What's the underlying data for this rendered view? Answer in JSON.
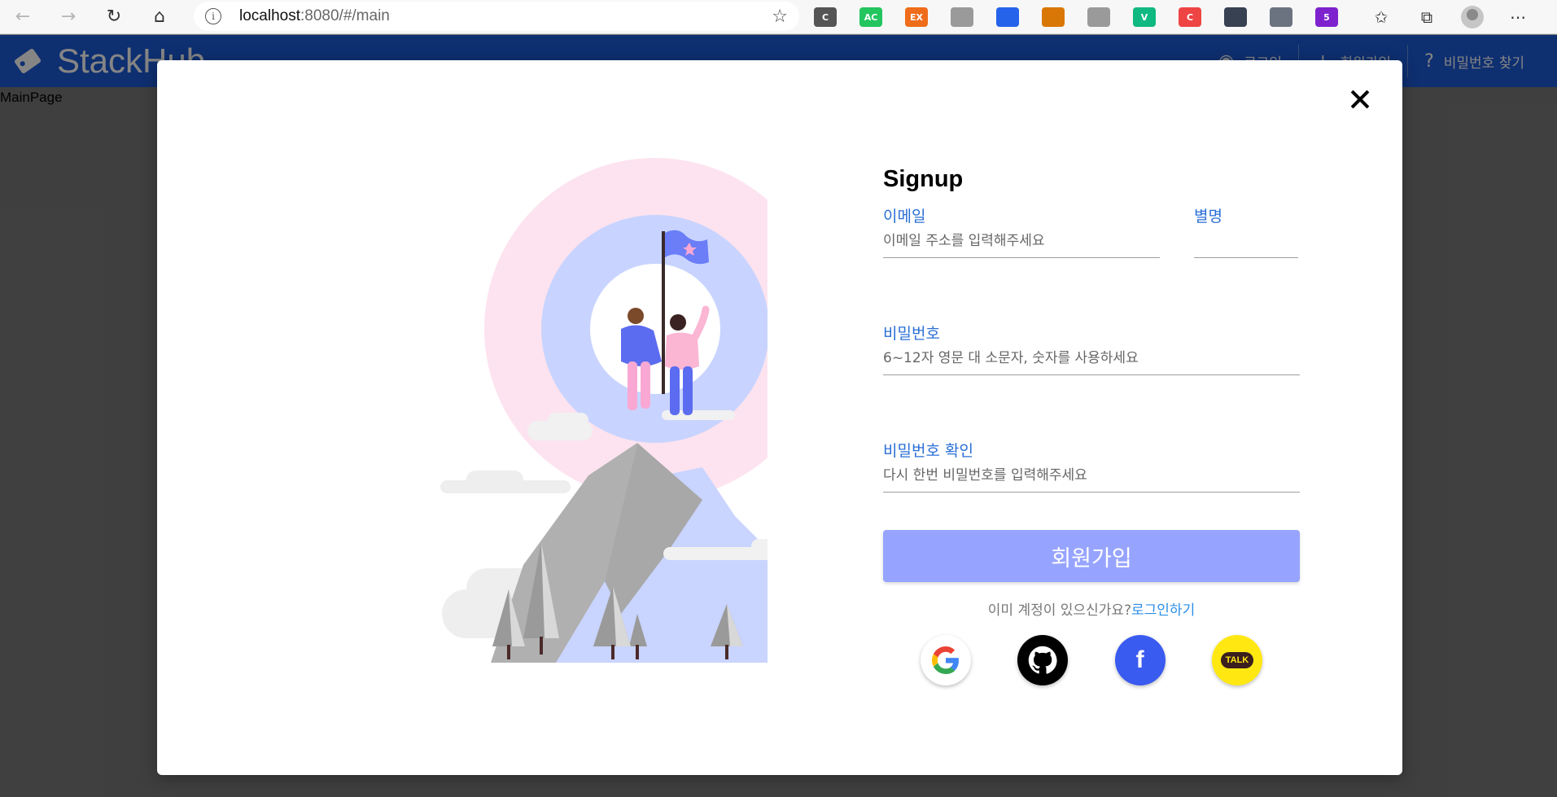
{
  "browser": {
    "url_host": "localhost",
    "url_rest": ":8080/#/main",
    "extensions": [
      {
        "name": "c-extension-icon",
        "label": "C",
        "color": "#555555"
      },
      {
        "name": "ac-extension-icon",
        "label": "AC",
        "color": "#22c55e"
      },
      {
        "name": "ex-extension-icon",
        "label": "EX",
        "color": "#ef6c1b"
      },
      {
        "name": "ext-icon-4",
        "label": "",
        "color": "#9a9a9a"
      },
      {
        "name": "dropper-extension-icon",
        "label": "",
        "color": "#2563eb"
      },
      {
        "name": "ext-icon-6",
        "label": "",
        "color": "#d97706"
      },
      {
        "name": "ext-icon-7",
        "label": "",
        "color": "#9a9a9a"
      },
      {
        "name": "vue-extension-icon",
        "label": "V",
        "color": "#10b981"
      },
      {
        "name": "ext-icon-9",
        "label": "C",
        "color": "#ef4444"
      },
      {
        "name": "ext-icon-10",
        "label": "",
        "color": "#374151"
      },
      {
        "name": "ext-icon-11",
        "label": "",
        "color": "#6b7280"
      },
      {
        "name": "ext-icon-12",
        "label": "5",
        "color": "#7e22ce"
      }
    ]
  },
  "app": {
    "title": "StackHub",
    "nav": [
      {
        "label": "로그인"
      },
      {
        "label": "회원가입"
      },
      {
        "label": "비밀번호 찾기"
      }
    ],
    "page_label": "MainPage"
  },
  "modal": {
    "title": "Signup",
    "fields": {
      "email": {
        "label": "이메일",
        "placeholder": "이메일 주소를 입력해주세요"
      },
      "nickname": {
        "label": "별명",
        "placeholder": ""
      },
      "password": {
        "label": "비밀번호",
        "placeholder": "6~12자 영문 대 소문자, 숫자를 사용하세요"
      },
      "password_confirm": {
        "label": "비밀번호 확인",
        "placeholder": "다시 한번 비밀번호를 입력해주세요"
      }
    },
    "submit_label": "회원가입",
    "login_prompt": "이미 계정이 있으신가요?",
    "login_link": "로그인하기",
    "social": [
      "google",
      "github",
      "facebook",
      "kakao"
    ],
    "kakao_label": "TALK",
    "facebook_label": "f"
  },
  "colors": {
    "accent": "#2a6fd6",
    "button": "#97a4ff",
    "header": "#1b5bd6"
  }
}
